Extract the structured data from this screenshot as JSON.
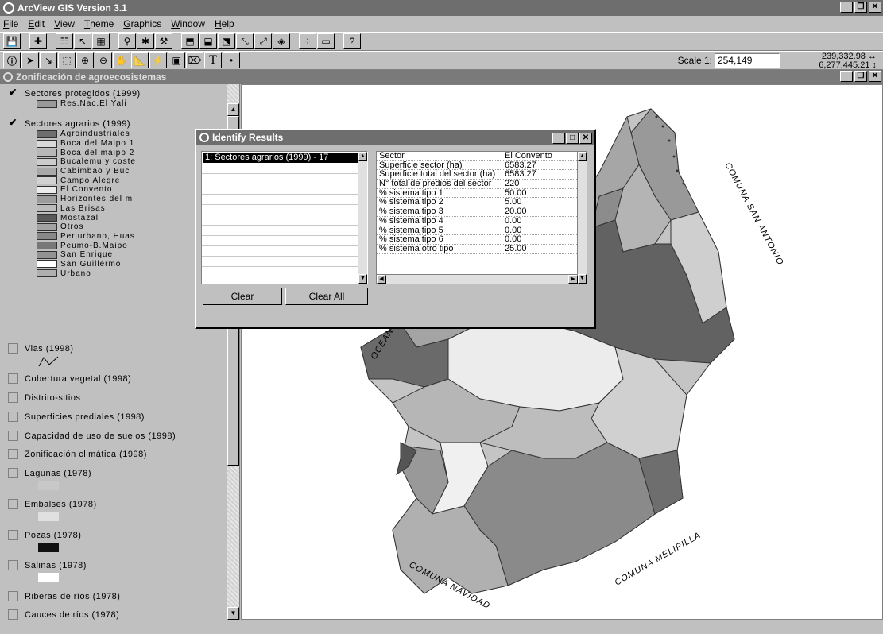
{
  "app": {
    "title": "ArcView GIS Version 3.1"
  },
  "menu": [
    "File",
    "Edit",
    "View",
    "Theme",
    "Graphics",
    "Window",
    "Help"
  ],
  "toolbar2": {
    "scale_label": "Scale 1:",
    "scale_value": "254,149",
    "coord_x": "239,332.98",
    "coord_y": "6,277,445.21"
  },
  "view": {
    "title": "Zonificación de agroecosistemas"
  },
  "legend": {
    "protected_theme": "Sectores protegidos (1999)",
    "protected_class": "Res.Nac.El Yali",
    "agrarian_theme": "Sectores agrarios (1999)",
    "agrarian_classes": [
      "Agroindustriales",
      "Boca del Maipo 1",
      "Boca del maipo 2",
      "Bucalemu y coste",
      "Cabimbao y Buc",
      "Campo Alegre",
      "El Convento",
      "Horizontes del m",
      "Las Brisas",
      "Mostazal",
      "Otros",
      "Periurbano, Huas",
      "Peumo-B.Maipo",
      "San Enrique",
      "San Guillermo",
      "Urbano"
    ],
    "agrarian_colors": [
      "#6e6e6e",
      "#dadada",
      "#b8b8b8",
      "#cccccc",
      "#a8a8a8",
      "#d2d2d2",
      "#ececec",
      "#9c9c9c",
      "#bcbcbc",
      "#5a5a5a",
      "#a2a2a2",
      "#888888",
      "#777777",
      "#939393",
      "#ffffff",
      "#b0b0b0"
    ],
    "other_themes": [
      "Vias (1998)",
      "Cobertura vegetal (1998)",
      "Distrito-sitios",
      "Superficies prediales (1998)",
      "Capacidad de uso de suelos (1998)",
      "Zonificación climática (1998)",
      "Lagunas (1978)",
      "Embalses (1978)",
      "Pozas (1978)",
      "Salinas (1978)",
      "Riberas de ríos (1978)",
      "Cauces de ríos (1978)"
    ]
  },
  "identify": {
    "title": "Identify Results",
    "result_item": "1:  Sectores agrarios (1999) - 17",
    "rows": [
      [
        "Sector",
        "El Convento"
      ],
      [
        "Superficie sector (ha)",
        "6583.27"
      ],
      [
        "Superficie total del sector (ha)",
        "6583.27"
      ],
      [
        "N° total de predios del sector",
        "220"
      ],
      [
        "% sistema tipo 1",
        "50.00"
      ],
      [
        "% sistema tipo 2",
        "5.00"
      ],
      [
        "% sistema tipo 3",
        "20.00"
      ],
      [
        "% sistema tipo 4",
        "0.00"
      ],
      [
        "% sistema tipo 5",
        "0.00"
      ],
      [
        "% sistema tipo 6",
        "0.00"
      ],
      [
        "% sistema otro tipo",
        "25.00"
      ]
    ],
    "clear_label": "Clear",
    "clear_all_label": "Clear All"
  },
  "map_labels": {
    "san_antonio": "COMUNA SAN ANTONIO",
    "navidad": "COMUNA NAVIDAD",
    "melipilla": "COMUNA MELIPILLA",
    "ocean": "OCEAN"
  }
}
